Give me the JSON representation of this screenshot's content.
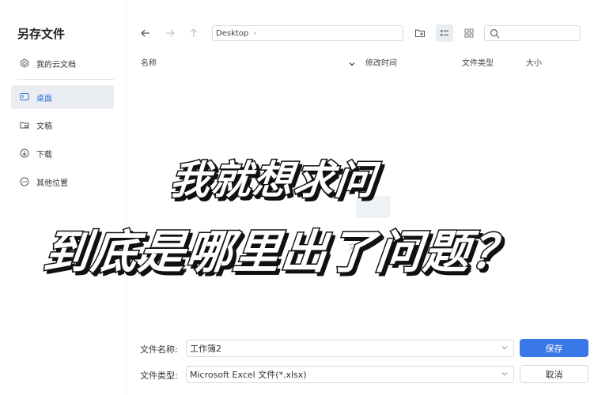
{
  "dialog": {
    "title": "另存文件"
  },
  "sidebar": {
    "items": [
      {
        "label": "我的云文档",
        "icon": "cloud-doc-icon"
      },
      {
        "label": "桌面",
        "icon": "desktop-icon",
        "active": true
      },
      {
        "label": "文稿",
        "icon": "documents-icon"
      },
      {
        "label": "下载",
        "icon": "download-icon"
      },
      {
        "label": "其他位置",
        "icon": "more-icon"
      }
    ]
  },
  "toolbar": {
    "path": "Desktop"
  },
  "file_list": {
    "columns": [
      "名称",
      "修改时间",
      "文件类型",
      "大小"
    ],
    "empty_hint_fragment": "文本 下"
  },
  "overlay": {
    "line1": "我就想求问",
    "line2": "到底是哪里出了问题？"
  },
  "form": {
    "name_label": "文件名称:",
    "name_value": "工作簿2",
    "type_label": "文件类型:",
    "type_value": "Microsoft Excel 文件(*.xlsx)",
    "save_label": "保存",
    "cancel_label": "取消"
  },
  "colors": {
    "accent": "#3a78e7",
    "sidebar_active_bg": "#eaeef3"
  }
}
